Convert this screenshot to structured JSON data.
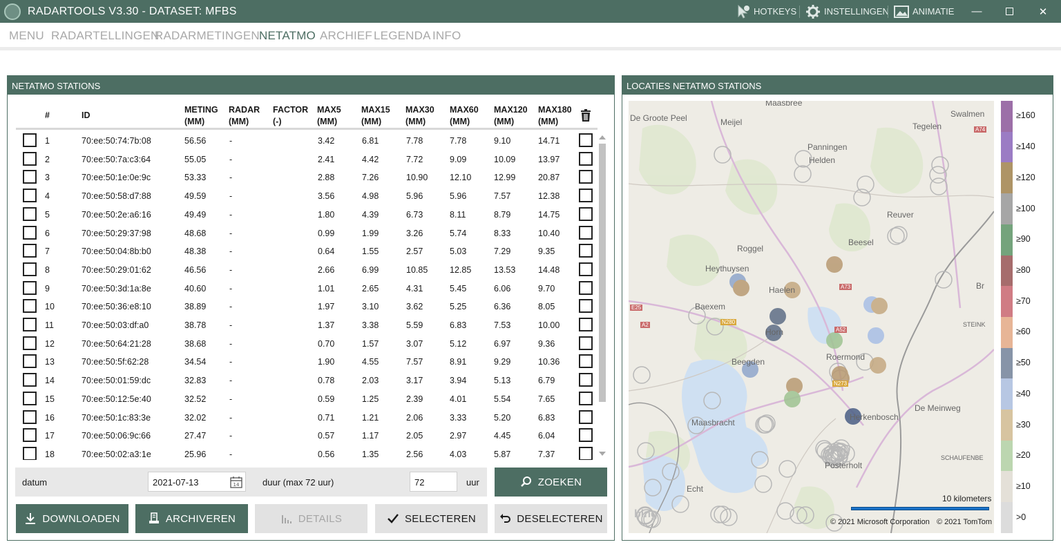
{
  "app": {
    "title": "RADARTOOLS V3.30 - DATASET: MFBS",
    "hotkeys": "HOTKEYS",
    "settings": "INSTELLINGEN",
    "animation": "ANIMATIE"
  },
  "menu": [
    "MENU",
    "RADARTELLINGEN",
    "RADARMETINGEN",
    "NETATMO",
    "ARCHIEF",
    "LEGENDA",
    "INFO"
  ],
  "menu_active": "NETATMO",
  "stations_panel": {
    "title": "NETATMO STATIONS",
    "columns": {
      "num": "#",
      "id": "ID",
      "meting": [
        "METING",
        "(MM)"
      ],
      "radar": [
        "RADAR",
        "(MM)"
      ],
      "factor": [
        "FACTOR",
        "(-)"
      ],
      "max5": [
        "MAX5",
        "(MM)"
      ],
      "max15": [
        "MAX15",
        "(MM)"
      ],
      "max30": [
        "MAX30",
        "(MM)"
      ],
      "max60": [
        "MAX60",
        "(MM)"
      ],
      "max120": [
        "MAX120",
        "(MM)"
      ],
      "max180": [
        "MAX180",
        "(MM)"
      ]
    },
    "rows": [
      [
        "1",
        "70:ee:50:74:7b:08",
        "56.56",
        "-",
        "",
        "3.42",
        "6.81",
        "7.78",
        "7.78",
        "9.10",
        "14.71"
      ],
      [
        "2",
        "70:ee:50:7a:c3:64",
        "55.05",
        "-",
        "",
        "2.41",
        "4.42",
        "7.72",
        "9.09",
        "10.09",
        "13.97"
      ],
      [
        "3",
        "70:ee:50:1e:0e:9c",
        "53.33",
        "-",
        "",
        "2.88",
        "7.26",
        "10.90",
        "12.10",
        "12.99",
        "20.87"
      ],
      [
        "4",
        "70:ee:50:58:d7:88",
        "49.59",
        "-",
        "",
        "3.56",
        "4.98",
        "5.96",
        "5.96",
        "7.57",
        "12.38"
      ],
      [
        "5",
        "70:ee:50:2e:a6:16",
        "49.49",
        "-",
        "",
        "1.80",
        "4.39",
        "6.73",
        "8.11",
        "8.79",
        "14.75"
      ],
      [
        "6",
        "70:ee:50:29:37:98",
        "48.68",
        "-",
        "",
        "0.99",
        "1.99",
        "3.26",
        "5.74",
        "8.33",
        "10.40"
      ],
      [
        "7",
        "70:ee:50:04:8b:b0",
        "48.38",
        "-",
        "",
        "0.64",
        "1.55",
        "2.57",
        "5.03",
        "7.29",
        "9.35"
      ],
      [
        "8",
        "70:ee:50:29:01:62",
        "46.56",
        "-",
        "",
        "2.66",
        "6.99",
        "10.85",
        "12.85",
        "13.53",
        "14.48"
      ],
      [
        "9",
        "70:ee:50:3d:1a:8e",
        "40.60",
        "-",
        "",
        "1.01",
        "2.65",
        "4.31",
        "5.45",
        "6.06",
        "9.70"
      ],
      [
        "10",
        "70:ee:50:36:e8:10",
        "38.89",
        "-",
        "",
        "1.97",
        "3.10",
        "3.62",
        "5.25",
        "6.36",
        "8.05"
      ],
      [
        "11",
        "70:ee:50:03:df:a0",
        "38.78",
        "-",
        "",
        "1.37",
        "3.38",
        "5.59",
        "6.83",
        "7.53",
        "10.00"
      ],
      [
        "12",
        "70:ee:50:64:21:28",
        "38.68",
        "-",
        "",
        "0.70",
        "1.57",
        "3.07",
        "5.12",
        "6.97",
        "9.36"
      ],
      [
        "13",
        "70:ee:50:5f:62:28",
        "34.54",
        "-",
        "",
        "1.90",
        "4.55",
        "7.57",
        "8.91",
        "9.29",
        "10.36"
      ],
      [
        "14",
        "70:ee:50:01:59:dc",
        "32.83",
        "-",
        "",
        "0.78",
        "2.03",
        "3.17",
        "3.94",
        "5.13",
        "6.79"
      ],
      [
        "15",
        "70:ee:50:12:5e:40",
        "32.52",
        "-",
        "",
        "0.59",
        "1.25",
        "2.39",
        "4.01",
        "5.54",
        "7.65"
      ],
      [
        "16",
        "70:ee:50:1c:83:3e",
        "32.02",
        "-",
        "",
        "0.71",
        "1.21",
        "2.06",
        "3.33",
        "5.20",
        "6.83"
      ],
      [
        "17",
        "70:ee:50:06:9c:66",
        "27.47",
        "-",
        "",
        "0.57",
        "1.17",
        "2.05",
        "2.97",
        "4.45",
        "6.04"
      ],
      [
        "18",
        "70:ee:50:02:a3:1e",
        "25.96",
        "-",
        "",
        "0.56",
        "1.35",
        "2.56",
        "4.03",
        "5.87",
        "7.37"
      ]
    ],
    "search": {
      "date_label": "datum",
      "date_value": "2021-07-13",
      "duration_label": "duur (max 72 uur)",
      "duration_value": "72",
      "unit": "uur",
      "search_button": "ZOEKEN"
    },
    "buttons": {
      "download": "DOWNLOADEN",
      "archive": "ARCHIVEREN",
      "details": "DETAILS",
      "select": "SELECTEREN",
      "deselect": "DESELECTEREN"
    }
  },
  "map_panel": {
    "title": "LOCATIES NETATMO STATIONS",
    "places": [
      "Maasbree",
      "De Groote Peel",
      "Meijel",
      "Tegelen",
      "Panningen",
      "Helden",
      "Reuver",
      "Roggel",
      "Beesel",
      "Heythuysen",
      "Haelen",
      "Baexem",
      "Horn",
      "Roermond",
      "Beegden",
      "De Meinweg",
      "Maasbracht",
      "Herkenbosch",
      "Posterholt",
      "Echt",
      "Swalmen",
      "Br",
      "STEINK",
      "SCHAUFENBE"
    ],
    "road_labels": [
      "A74",
      "A73",
      "N280",
      "E25",
      "A2",
      "A52",
      "N273"
    ],
    "scale": "10 kilometers",
    "attribution": [
      "© 2021 Microsoft Corporation",
      "© 2021 TomTom"
    ],
    "brand": "bing",
    "legend": {
      "labels": [
        "≥160",
        "≥140",
        "≥120",
        "≥100",
        "≥90",
        "≥80",
        "≥70",
        "≥60",
        "≥50",
        "≥40",
        "≥30",
        "≥20",
        "≥10",
        ">0"
      ],
      "colors": [
        "#9c6fa8",
        "#9b7cc4",
        "#ae9466",
        "#a6a6a6",
        "#74a37c",
        "#a66c6c",
        "#d07c84",
        "#e7b596",
        "#8794a8",
        "#b7c7e3",
        "#d7c4a0",
        "#bcd6b0",
        "#e4e0d8",
        "#dcdcdc"
      ]
    }
  }
}
